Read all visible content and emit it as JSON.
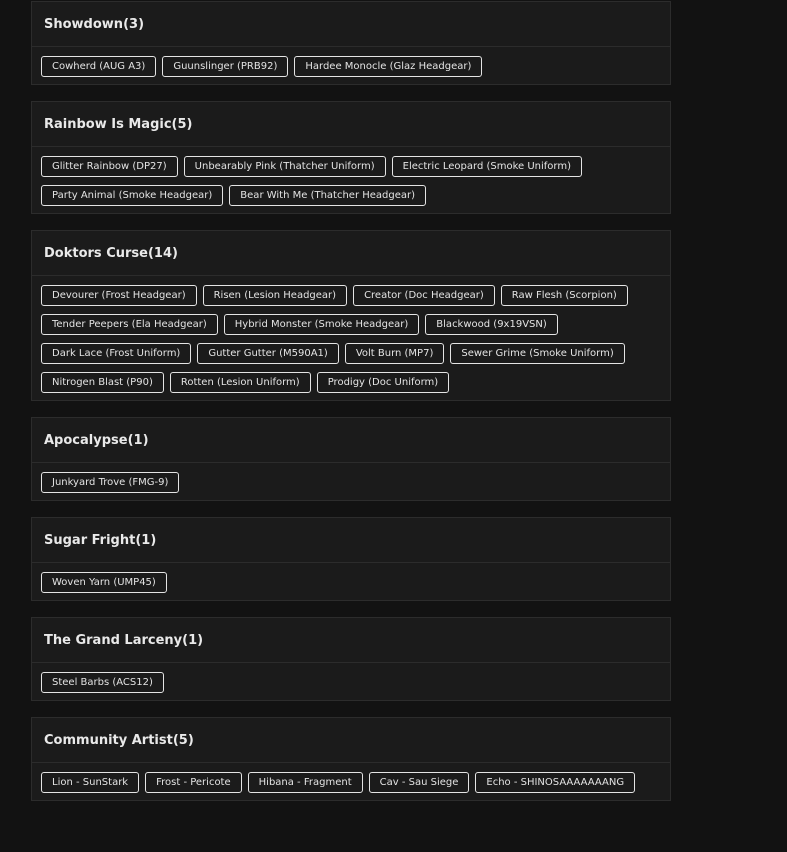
{
  "collections": [
    {
      "name": "Showdown",
      "count": "3",
      "items": [
        "Cowherd (AUG A3)",
        "Guunslinger (PRB92)",
        "Hardee Monocle (Glaz Headgear)"
      ]
    },
    {
      "name": "Rainbow Is Magic",
      "count": "5",
      "items": [
        "Glitter Rainbow (DP27)",
        "Unbearably Pink (Thatcher Uniform)",
        "Electric Leopard (Smoke Uniform)",
        "Party Animal (Smoke Headgear)",
        "Bear With Me (Thatcher Headgear)"
      ]
    },
    {
      "name": "Doktors Curse",
      "count": "14",
      "items": [
        "Devourer (Frost Headgear)",
        "Risen (Lesion Headgear)",
        "Creator (Doc Headgear)",
        "Raw Flesh (Scorpion)",
        "Tender Peepers (Ela Headgear)",
        "Hybrid Monster (Smoke Headgear)",
        "Blackwood (9x19VSN)",
        "Dark Lace (Frost Uniform)",
        "Gutter Gutter (M590A1)",
        "Volt Burn (MP7)",
        "Sewer Grime (Smoke Uniform)",
        "Nitrogen Blast (P90)",
        "Rotten (Lesion Uniform)",
        "Prodigy (Doc Uniform)"
      ]
    },
    {
      "name": "Apocalypse",
      "count": "1",
      "items": [
        "Junkyard Trove (FMG-9)"
      ]
    },
    {
      "name": "Sugar Fright",
      "count": "1",
      "items": [
        "Woven Yarn (UMP45)"
      ]
    },
    {
      "name": "The Grand Larceny",
      "count": "1",
      "items": [
        "Steel Barbs (ACS12)"
      ]
    },
    {
      "name": "Community Artist",
      "count": "5",
      "items": [
        "Lion - SunStark",
        "Frost - Pericote",
        "Hibana - Fragment",
        "Cav - Sau Siege",
        "Echo - SHINOSAAAAAAANG"
      ]
    }
  ]
}
